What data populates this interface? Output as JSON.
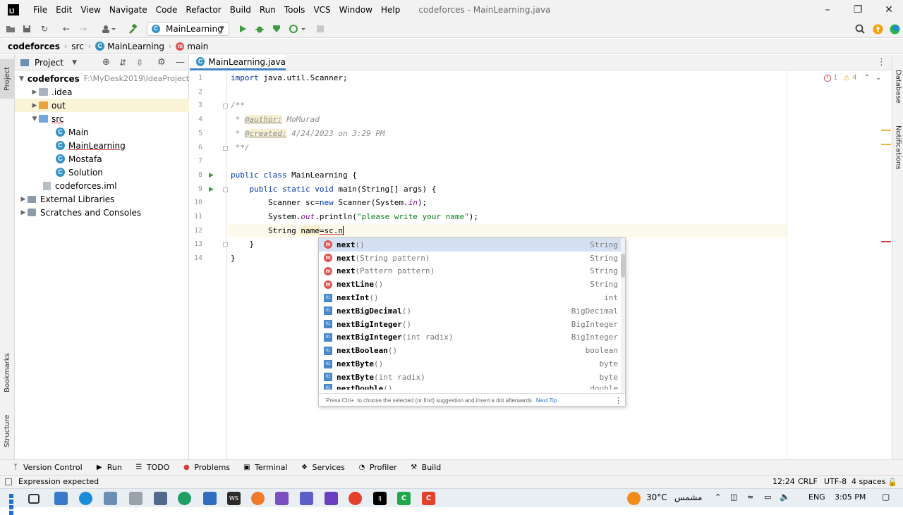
{
  "menu": [
    "File",
    "Edit",
    "View",
    "Navigate",
    "Code",
    "Refactor",
    "Build",
    "Run",
    "Tools",
    "VCS",
    "Window",
    "Help"
  ],
  "window_title": "codeforces - MainLearning.java",
  "toolbar": {
    "run_config": "MainLearning"
  },
  "breadcrumb": [
    "codeforces",
    "src",
    "MainLearning",
    "main"
  ],
  "project_panel": {
    "title": "Project",
    "tree": [
      {
        "label": "codeforces",
        "path": "F:\\MyDesk2019\\IdeaProjects\\"
      },
      {
        "label": ".idea"
      },
      {
        "label": "out"
      },
      {
        "label": "src"
      },
      {
        "label": "Main"
      },
      {
        "label": "MainLearning"
      },
      {
        "label": "Mostafa"
      },
      {
        "label": "Solution"
      },
      {
        "label": "codeforces.iml"
      },
      {
        "label": "External Libraries"
      },
      {
        "label": "Scratches and Consoles"
      }
    ]
  },
  "editor": {
    "tab": "MainLearning.java",
    "line_numbers": [
      "1",
      "2",
      "3",
      "4",
      "5",
      "6",
      "7",
      "8",
      "9",
      "10",
      "11",
      "12",
      "13",
      "14"
    ],
    "lines": {
      "l1a": "import",
      "l1b": " java.util.Scanner;",
      "l3": "/**",
      "l4a": " * ",
      "l4b": "@author:",
      "l4c": " MoMurad",
      "l5a": " * ",
      "l5b": "@created:",
      "l5c": " 4/24/2023 on 3:29 PM",
      "l6": " **/",
      "l8a": "public class",
      "l8b": " MainLearning {",
      "l9a": "    public static void",
      "l9b": " main(String[] args) {",
      "l10a": "        Scanner sc=",
      "l10b": "new",
      "l10c": " Scanner(System.",
      "l10d": "in",
      "l10e": ");",
      "l11a": "        System.",
      "l11b": "out",
      "l11c": ".println(",
      "l11d": "\"please write your name\"",
      "l11e": ");",
      "l12a": "        String ",
      "l12b": "name",
      "l12c": "=sc.n",
      "l13": "    }",
      "l14": "}"
    },
    "errors": "1",
    "warnings": "4"
  },
  "completion": {
    "items": [
      {
        "name": "next",
        "params": "()",
        "type": "String",
        "kind": "method"
      },
      {
        "name": "next",
        "params": "(String pattern)",
        "type": "String",
        "kind": "method"
      },
      {
        "name": "next",
        "params": "(Pattern pattern)",
        "type": "String",
        "kind": "method"
      },
      {
        "name": "nextLine",
        "params": "()",
        "type": "String",
        "kind": "method"
      },
      {
        "name": "nextInt",
        "params": "()",
        "type": "int",
        "kind": "field"
      },
      {
        "name": "nextBigDecimal",
        "params": "()",
        "type": "BigDecimal",
        "kind": "field"
      },
      {
        "name": "nextBigInteger",
        "params": "()",
        "type": "BigInteger",
        "kind": "field"
      },
      {
        "name": "nextBigInteger",
        "params": "(int radix)",
        "type": "BigInteger",
        "kind": "field"
      },
      {
        "name": "nextBoolean",
        "params": "()",
        "type": "boolean",
        "kind": "field"
      },
      {
        "name": "nextByte",
        "params": "()",
        "type": "byte",
        "kind": "field"
      },
      {
        "name": "nextByte",
        "params": "(int radix)",
        "type": "byte",
        "kind": "field"
      },
      {
        "name": "nextDouble",
        "params": "()",
        "type": "double",
        "kind": "field"
      }
    ],
    "footer": "Press Ctrl+. to choose the selected (or first) suggestion and insert a dot afterwards",
    "next_tip": "Next Tip"
  },
  "side_tabs": {
    "project": "Project",
    "bookmarks": "Bookmarks",
    "structure": "Structure",
    "database": "Database",
    "notifications": "Notifications"
  },
  "tool_windows": [
    "Version Control",
    "Run",
    "TODO",
    "Problems",
    "Terminal",
    "Services",
    "Profiler",
    "Build"
  ],
  "status": {
    "message": "Expression expected",
    "position": "12:24",
    "line_sep": "CRLF",
    "encoding": "UTF-8",
    "indent": "4 spaces"
  },
  "taskbar": {
    "weather": "30°C",
    "weather_desc": "مشمس",
    "lang": "ENG",
    "time": "3:05 PM"
  },
  "colors": {
    "accent": "#4083c9",
    "keyword": "#0033b3",
    "string": "#067d17",
    "selection": "#d5e1f2"
  }
}
